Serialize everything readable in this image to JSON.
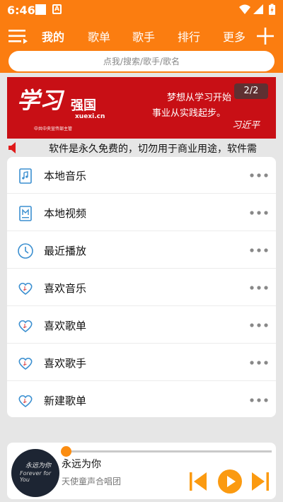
{
  "status_bar": {
    "time": "6:46",
    "a_icon_label": "A"
  },
  "nav": {
    "tabs": [
      {
        "label": "我的",
        "active": true
      },
      {
        "label": "歌单",
        "active": false
      },
      {
        "label": "歌手",
        "active": false
      },
      {
        "label": "排行",
        "active": false
      },
      {
        "label": "更多",
        "active": false
      }
    ]
  },
  "search": {
    "placeholder": "点我/搜索/歌手/歌名"
  },
  "banner": {
    "logo": "学习",
    "brand": "强国",
    "url": "xuexi.cn",
    "sub": "中共中央宣传部主管",
    "slogan_line1": "梦想从学习开始",
    "slogan_line2": "事业从实践起步。",
    "signature": "习近平",
    "counter": "2/2"
  },
  "notice": {
    "text": "软件是永久免费的，切勿用于商业用途，软件需"
  },
  "menu": {
    "items": [
      {
        "label": "本地音乐",
        "icon": "music-file-icon"
      },
      {
        "label": "本地视频",
        "icon": "video-file-icon"
      },
      {
        "label": "最近播放",
        "icon": "clock-icon"
      },
      {
        "label": "喜欢音乐",
        "icon": "heart-music-icon"
      },
      {
        "label": "喜欢歌单",
        "icon": "heart-music-icon"
      },
      {
        "label": "喜欢歌手",
        "icon": "heart-music-icon"
      },
      {
        "label": "新建歌单",
        "icon": "heart-music-icon"
      }
    ]
  },
  "player": {
    "title": "永远为你",
    "artist": "天使童声合唱团",
    "album_title": "永远为你",
    "album_subtitle": "Forever for You",
    "progress": 0.0
  },
  "colors": {
    "accent": "#fb7d10",
    "icon_blue": "#3b8fd0",
    "banner_red": "#c80f15"
  }
}
